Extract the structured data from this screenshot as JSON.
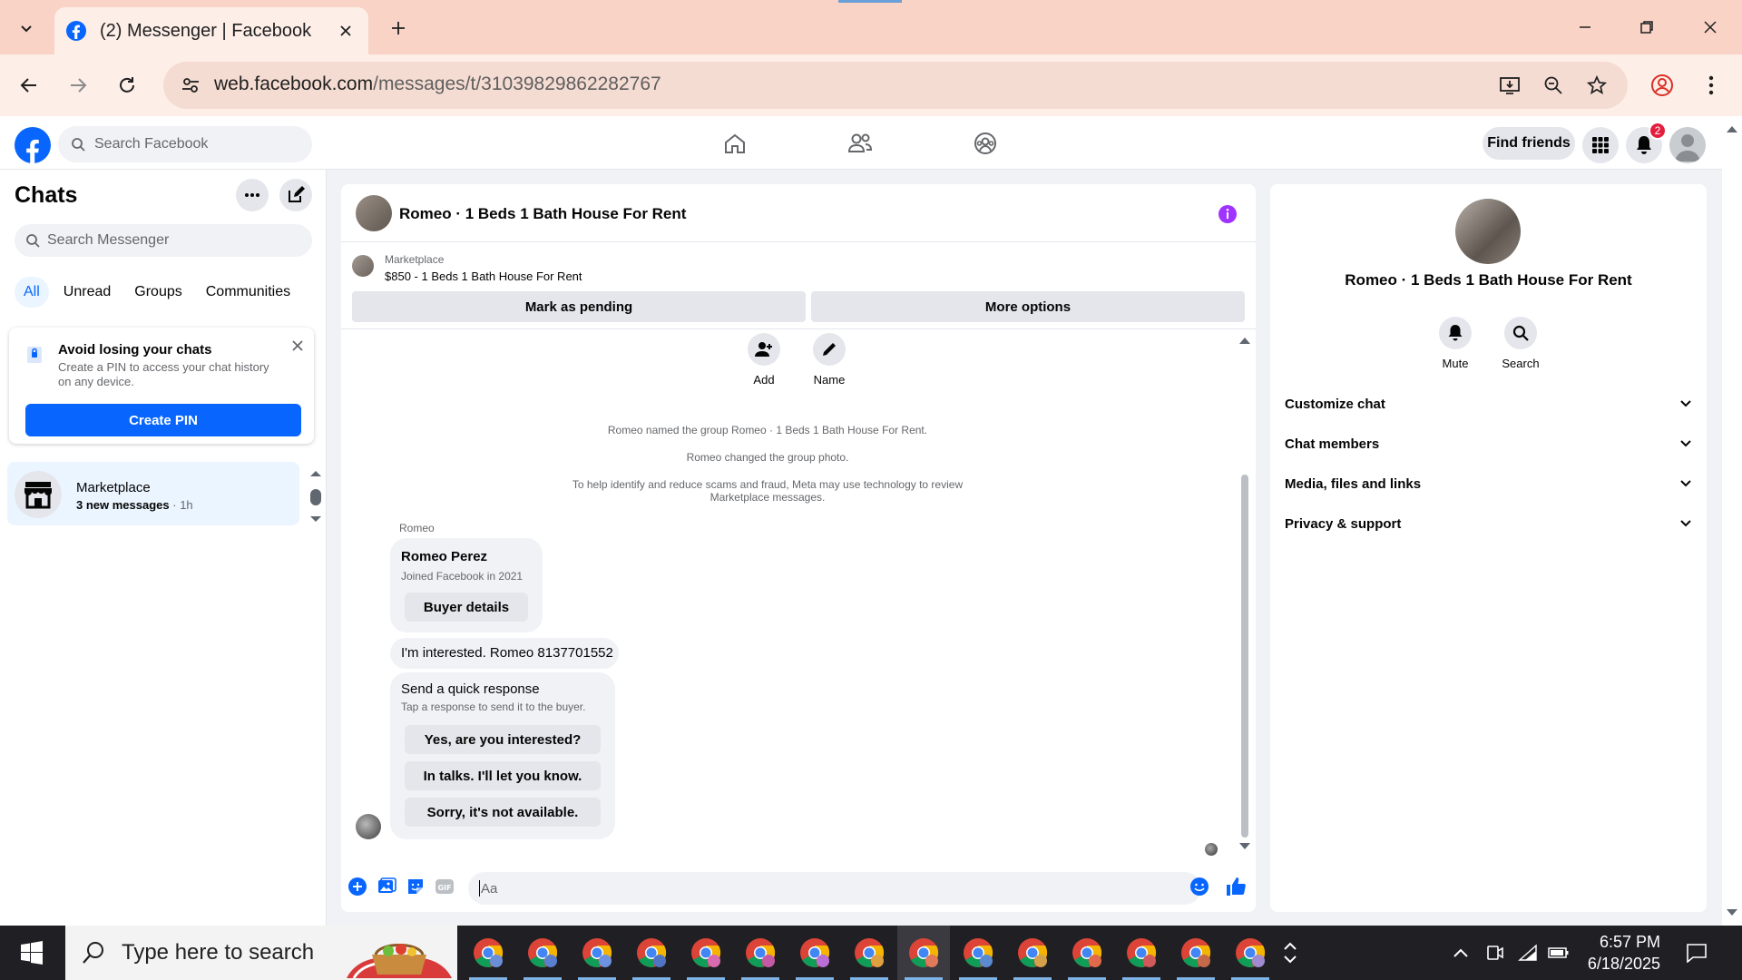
{
  "browser": {
    "tab_title": "(2) Messenger | Facebook",
    "url_host": "web.facebook.com",
    "url_path": "/messages/t/31039829862282767"
  },
  "header": {
    "search_placeholder": "Search Facebook",
    "find_friends": "Find friends",
    "notification_count": "2"
  },
  "sidebar": {
    "title": "Chats",
    "search_placeholder": "Search Messenger",
    "filters": [
      "All",
      "Unread",
      "Groups",
      "Communities"
    ],
    "pin_card": {
      "title": "Avoid losing your chats",
      "description": "Create a PIN to access your chat history on any device.",
      "button": "Create PIN"
    },
    "conversations": [
      {
        "name": "Marketplace",
        "meta": "3 new messages",
        "time": "1h"
      }
    ]
  },
  "chat": {
    "title": "Romeo · 1 Beds 1 Bath House For Rent",
    "marketplace_label": "Marketplace",
    "listing": "$850 - 1 Beds 1 Bath House For Rent",
    "mark_pending": "Mark as pending",
    "more_options": "More options",
    "actions": [
      {
        "label": "Add",
        "icon": "add-person-icon"
      },
      {
        "label": "Name",
        "icon": "pencil-icon"
      }
    ],
    "system_messages": [
      "Romeo named the group Romeo · 1 Beds 1 Bath House For Rent.",
      "Romeo changed the group photo.",
      "To help identify and reduce scams and fraud, Meta may use technology to review Marketplace messages."
    ],
    "sender": "Romeo",
    "buyer_card": {
      "name": "Romeo Perez",
      "joined": "Joined Facebook in 2021",
      "button": "Buyer details"
    },
    "message": "I'm interested. Romeo 8137701552",
    "quick_response": {
      "title": "Send a quick response",
      "subtitle": "Tap a response to send it to the buyer.",
      "options": [
        "Yes, are you interested?",
        "In talks. I'll let you know.",
        "Sorry, it's not available."
      ]
    },
    "composer_placeholder": "Aa"
  },
  "details": {
    "title": "Romeo · 1 Beds 1 Bath House For Rent",
    "actions": [
      {
        "label": "Mute",
        "icon": "bell-icon"
      },
      {
        "label": "Search",
        "icon": "search-icon"
      }
    ],
    "sections": [
      "Customize chat",
      "Chat members",
      "Media, files and links",
      "Privacy & support"
    ]
  },
  "taskbar": {
    "search_placeholder": "Type here to search",
    "time": "6:57 PM",
    "date": "6/18/2025"
  },
  "colors": {
    "accent": "#0866ff",
    "tab_bar": "#f9d3c6",
    "badge": "#e41e3f",
    "info": "#a033ff"
  }
}
